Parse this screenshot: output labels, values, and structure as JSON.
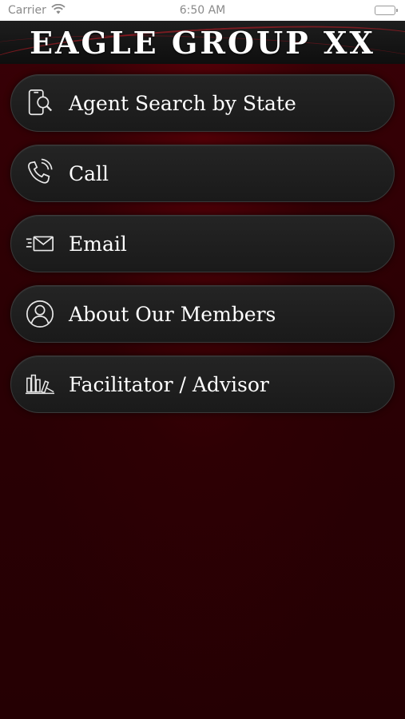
{
  "status_bar": {
    "carrier": "Carrier",
    "time": "6:50 AM"
  },
  "header": {
    "title": "EAGLE GROUP XX"
  },
  "menu": {
    "items": [
      {
        "label": "Agent Search by State",
        "icon": "phone-search-icon"
      },
      {
        "label": "Call",
        "icon": "phone-call-icon"
      },
      {
        "label": "Email",
        "icon": "email-icon"
      },
      {
        "label": "About Our Members",
        "icon": "user-profile-icon"
      },
      {
        "label": "Facilitator / Advisor",
        "icon": "books-icon"
      }
    ]
  },
  "colors": {
    "background": "#2a0003",
    "button": "#1f1f1f",
    "text": "#ffffff"
  }
}
